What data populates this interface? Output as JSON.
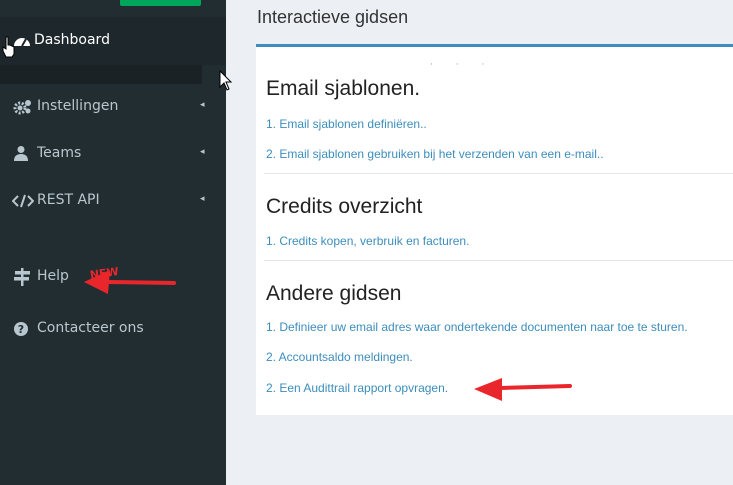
{
  "sidebar": {
    "dashboard_label": "Dashboard",
    "items": [
      {
        "label": "Instellingen",
        "icon": "gears-icon"
      },
      {
        "label": "Teams",
        "icon": "user-icon"
      },
      {
        "label": "REST API",
        "icon": "code-icon"
      }
    ],
    "help_label": "Help",
    "help_badge": "NEW",
    "contact_label": "Contacteer ons"
  },
  "content": {
    "title": "Interactieve gidsen",
    "sections": [
      {
        "title": "Email sjablonen.",
        "links": [
          "1. Email sjablonen definiëren..",
          "2. Email sjablonen gebruiken bij het verzenden van een e-mail.."
        ]
      },
      {
        "title": "Credits overzicht",
        "links": [
          "1. Credits kopen, verbruik en facturen."
        ]
      },
      {
        "title": "Andere gidsen",
        "links": [
          "1. Definieer uw email adres waar ondertekende documenten naar toe te sturen.",
          "2. Accountsaldo meldingen.",
          "2. Een Audittrail rapport opvragen."
        ]
      }
    ]
  },
  "colors": {
    "sidebar": "#222d32",
    "accent": "#3c8dbc",
    "annotation": "#e8262b",
    "green": "#00a65a"
  }
}
